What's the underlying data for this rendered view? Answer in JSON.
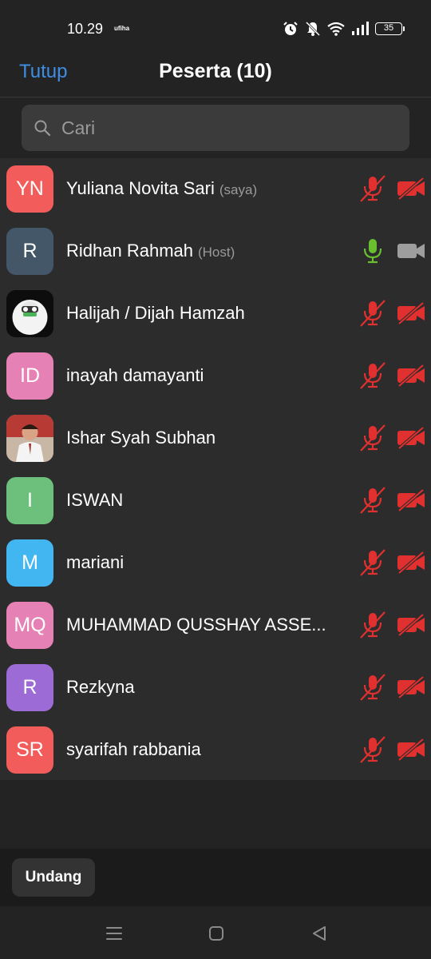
{
  "status_bar": {
    "time": "10.29",
    "carrier_mark": "ufiha",
    "battery": "35",
    "icons": [
      "alarm-icon",
      "mute-icon",
      "wifi-icon",
      "signal-icon",
      "battery-icon"
    ]
  },
  "header": {
    "close_label": "Tutup",
    "title": "Peserta (10)"
  },
  "search": {
    "placeholder": "Cari"
  },
  "colors": {
    "accent": "#3f8ee6",
    "muted_red": "#e0302f",
    "mic_on_green": "#6abf2e",
    "cam_off_gray": "#9e9e9e"
  },
  "participants": [
    {
      "initials": "YN",
      "name": "Yuliana Novita Sari",
      "tag": "(saya)",
      "avatar_color": "#f25c5a",
      "mic": "muted",
      "video": "off"
    },
    {
      "initials": "R",
      "name": "Ridhan Rahmah",
      "tag": "(Host)",
      "avatar_color": "#445769",
      "mic": "on",
      "video": "stopped"
    },
    {
      "initials": "",
      "name": "Halijah / Dijah Hamzah",
      "tag": "",
      "avatar_color": "#111111",
      "avatar_image": "cartoon-face",
      "mic": "muted",
      "video": "off"
    },
    {
      "initials": "ID",
      "name": "inayah damayanti",
      "tag": "",
      "avatar_color": "#e581b4",
      "mic": "muted",
      "video": "off"
    },
    {
      "initials": "",
      "name": "Ishar Syah Subhan",
      "tag": "",
      "avatar_color": "#c44a43",
      "avatar_image": "photo-child",
      "mic": "muted",
      "video": "off"
    },
    {
      "initials": "I",
      "name": "ISWAN",
      "tag": "",
      "avatar_color": "#6cc07b",
      "mic": "muted",
      "video": "off"
    },
    {
      "initials": "M",
      "name": "mariani",
      "tag": "",
      "avatar_color": "#42b6f0",
      "mic": "muted",
      "video": "off"
    },
    {
      "initials": "MQ",
      "name": "MUHAMMAD QUSSHAY ASSE...",
      "tag": "",
      "avatar_color": "#e581b4",
      "mic": "muted",
      "video": "off"
    },
    {
      "initials": "R",
      "name": "Rezkyna",
      "tag": "",
      "avatar_color": "#9c6bd6",
      "mic": "muted",
      "video": "off"
    },
    {
      "initials": "SR",
      "name": "syarifah rabbania",
      "tag": "",
      "avatar_color": "#f25c5a",
      "mic": "muted",
      "video": "off"
    }
  ],
  "footer": {
    "invite_label": "Undang"
  },
  "nav": [
    "menu-icon",
    "home-icon",
    "back-icon"
  ]
}
